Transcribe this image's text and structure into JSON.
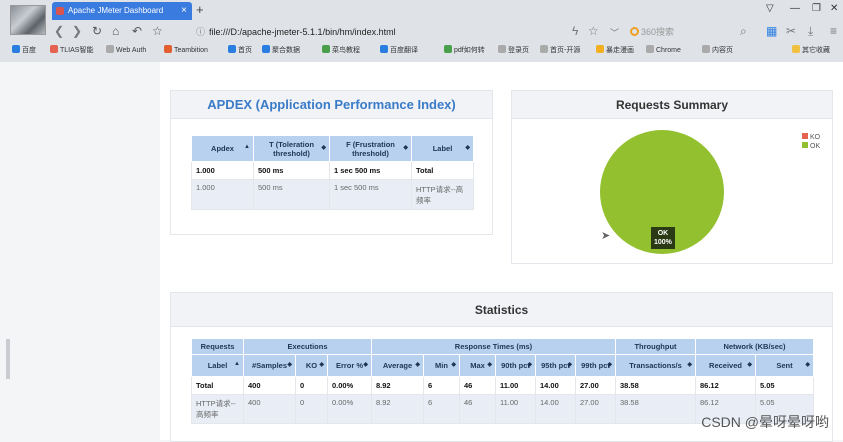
{
  "browser": {
    "tab_title": "Apache JMeter Dashboard",
    "url": "file:///D:/apache-jmeter-5.1.1/bin/hm/index.html",
    "search_placeholder": "360搜索",
    "bookmarks": [
      "百度",
      "TLIAS智能",
      "Web Auth",
      "Teambition",
      "首页",
      "聚合数据",
      "菜鸟教程",
      "百度翻译",
      "pdf如何转",
      "登录页",
      "首页-开源",
      "暴走漫画",
      "Chrome",
      "内容页",
      "其它收藏"
    ]
  },
  "apdex": {
    "title": "APDEX (Application Performance Index)",
    "headers": [
      "Apdex",
      "T (Toleration threshold)",
      "F (Frustration threshold)",
      "Label"
    ],
    "rows": [
      [
        "1.000",
        "500 ms",
        "1 sec 500 ms",
        "Total"
      ],
      [
        "1.000",
        "500 ms",
        "1 sec 500 ms",
        "HTTP请求--高频率"
      ]
    ]
  },
  "summary": {
    "title": "Requests Summary",
    "legend": [
      "KO",
      "OK"
    ],
    "slice_label": "OK",
    "slice_pct": "100%"
  },
  "chart_data": {
    "type": "pie",
    "title": "Requests Summary",
    "categories": [
      "KO",
      "OK"
    ],
    "values": [
      0,
      100
    ],
    "colors": [
      "#e4624f",
      "#93c02e"
    ]
  },
  "statistics": {
    "title": "Statistics",
    "groups": [
      "Requests",
      "Executions",
      "Response Times (ms)",
      "Throughput",
      "Network (KB/sec)"
    ],
    "headers": [
      "Label",
      "#Samples",
      "KO",
      "Error %",
      "Average",
      "Min",
      "Max",
      "90th pct",
      "95th pct",
      "99th pct",
      "Transactions/s",
      "Received",
      "Sent"
    ],
    "rows": [
      [
        "Total",
        "400",
        "0",
        "0.00%",
        "8.92",
        "6",
        "46",
        "11.00",
        "14.00",
        "27.00",
        "38.58",
        "86.12",
        "5.05"
      ],
      [
        "HTTP请求--高频率",
        "400",
        "0",
        "0.00%",
        "8.92",
        "6",
        "46",
        "11.00",
        "14.00",
        "27.00",
        "38.58",
        "86.12",
        "5.05"
      ]
    ]
  },
  "watermark": "CSDN @晕呀晕呀哟",
  "colors": {
    "header_blue": "#b8d1ee",
    "title_blue": "#3a7bc8",
    "pie_ok": "#93c02e",
    "pie_ko": "#e4624f"
  }
}
